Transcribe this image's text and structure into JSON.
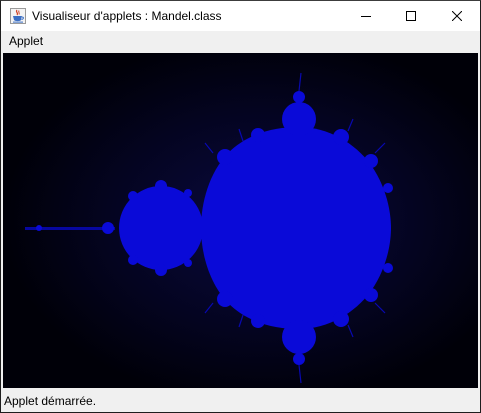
{
  "window": {
    "title": "Visualiseur d'applets : Mandel.class"
  },
  "menubar": {
    "items": [
      {
        "label": "Applet"
      }
    ]
  },
  "applet": {
    "content": "mandelbrot-set",
    "fill_color": "#0a0ad8",
    "background_color": "#000008"
  },
  "status": {
    "text": "Applet démarrée."
  },
  "icons": {
    "app": "java-cup-icon",
    "minimize": "minimize-icon",
    "maximize": "maximize-icon",
    "close": "close-icon"
  }
}
